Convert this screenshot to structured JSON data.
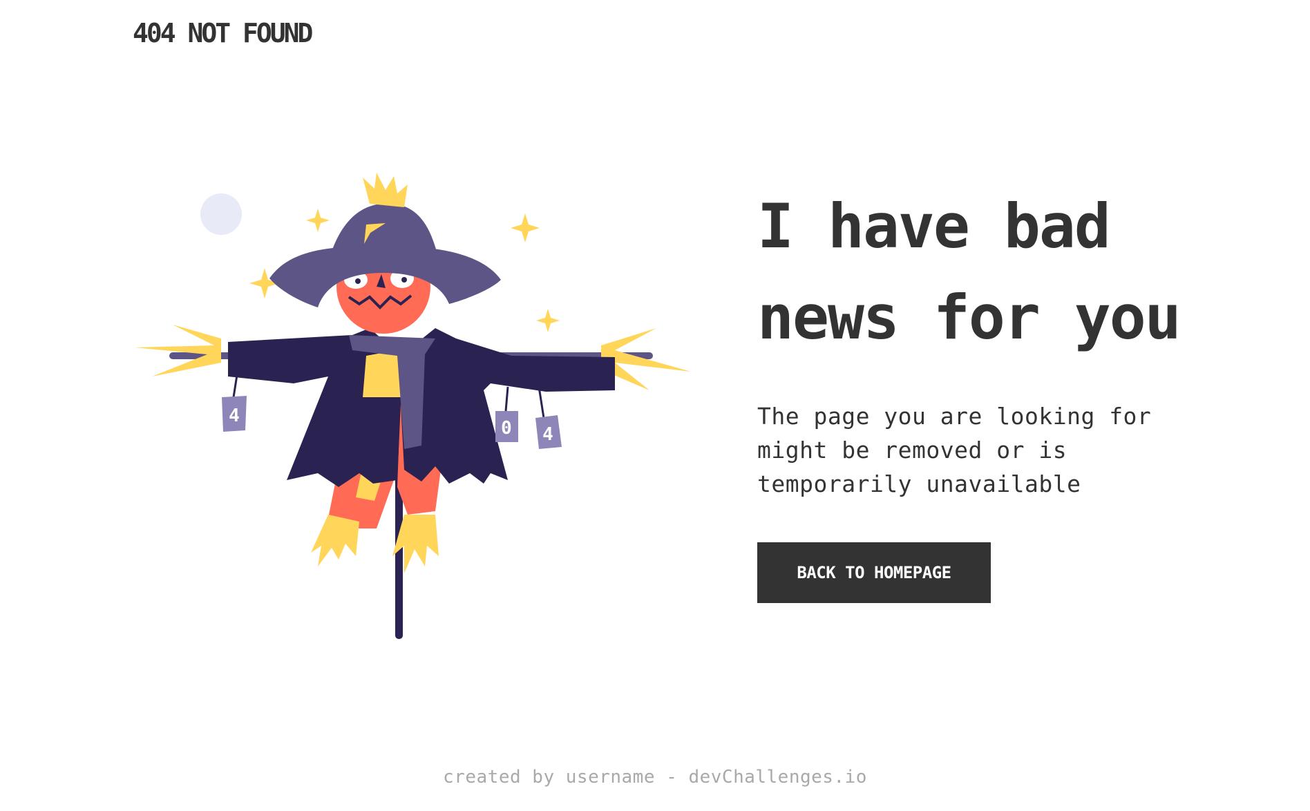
{
  "header": {
    "logo_text": "404 NOT FOUND"
  },
  "illustration": {
    "subject": "scarecrow",
    "cans": [
      "4",
      "0",
      "4"
    ],
    "colors": {
      "coat": "#2a2250",
      "hat": "#5e5587",
      "face": "#ff6b55",
      "straw": "#ffd55a",
      "moon": "#e8ebf7",
      "stick": "#2a2250"
    }
  },
  "main": {
    "headline": "I have bad news for you",
    "message": "The page you are looking for might be removed or is temporarily unavailable",
    "cta_label": "BACK TO HOMEPAGE"
  },
  "footer": {
    "credit": "created by username - devChallenges.io"
  },
  "theme": {
    "text_color": "#333333",
    "button_bg": "#333333",
    "button_text": "#ffffff",
    "footer_text": "#a9a9a9"
  }
}
